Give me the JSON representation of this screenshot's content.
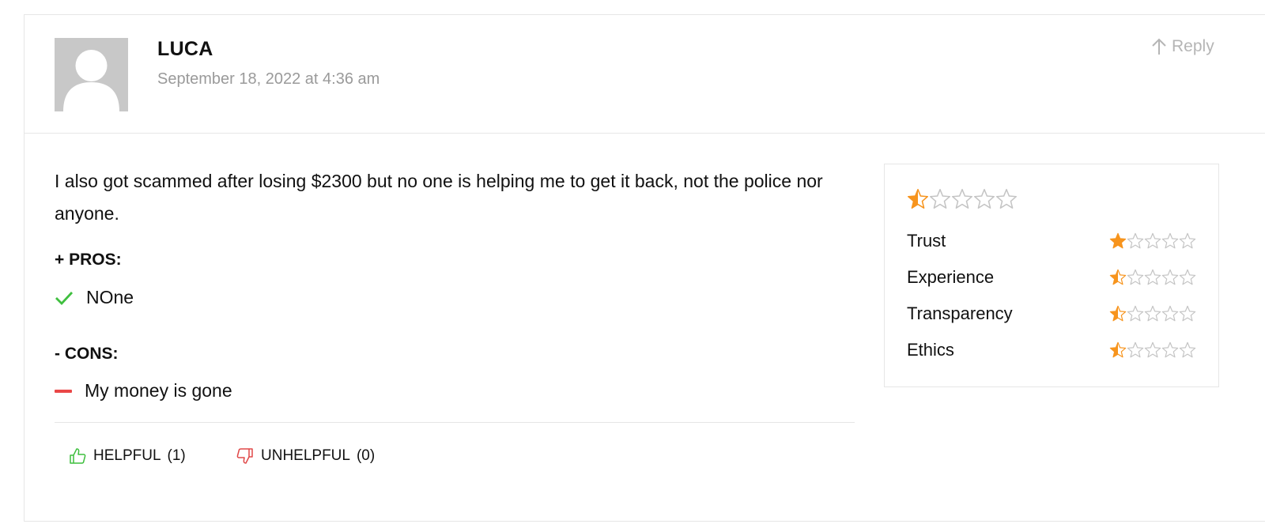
{
  "review": {
    "author": "LUCA",
    "date": "September 18, 2022 at 4:36 am",
    "reply_label": "Reply",
    "text": "I also got scammed after losing $2300 but no one is helping me to get it back, not the police nor anyone.",
    "pros_title": "+ PROS:",
    "pros": [
      "NOne"
    ],
    "cons_title": "- CONS:",
    "cons": [
      "My money is gone"
    ],
    "helpful": {
      "label": "HELPFUL",
      "count": "(1)"
    },
    "unhelpful": {
      "label": "UNHELPFUL",
      "count": "(0)"
    }
  },
  "rating": {
    "overall_fraction": 0.1,
    "criteria": [
      {
        "label": "Trust",
        "fraction": 0.2
      },
      {
        "label": "Experience",
        "fraction": 0.1
      },
      {
        "label": "Transparency",
        "fraction": 0.1
      },
      {
        "label": "Ethics",
        "fraction": 0.1
      }
    ]
  },
  "colors": {
    "star_filled": "#f7941d",
    "star_empty": "#c4c4c4",
    "check": "#3fbf3f",
    "minus": "#ea4747",
    "helpful_icon": "#3fbf3f",
    "unhelpful_icon": "#e04848",
    "muted_text": "#9a9a9a"
  },
  "icons": {
    "reply": "arrow-up-icon",
    "pro": "check-icon",
    "con": "minus-icon",
    "helpful": "thumbs-up-icon",
    "unhelpful": "thumbs-down-icon",
    "avatar": "user-placeholder-icon",
    "star": "star-icon"
  }
}
